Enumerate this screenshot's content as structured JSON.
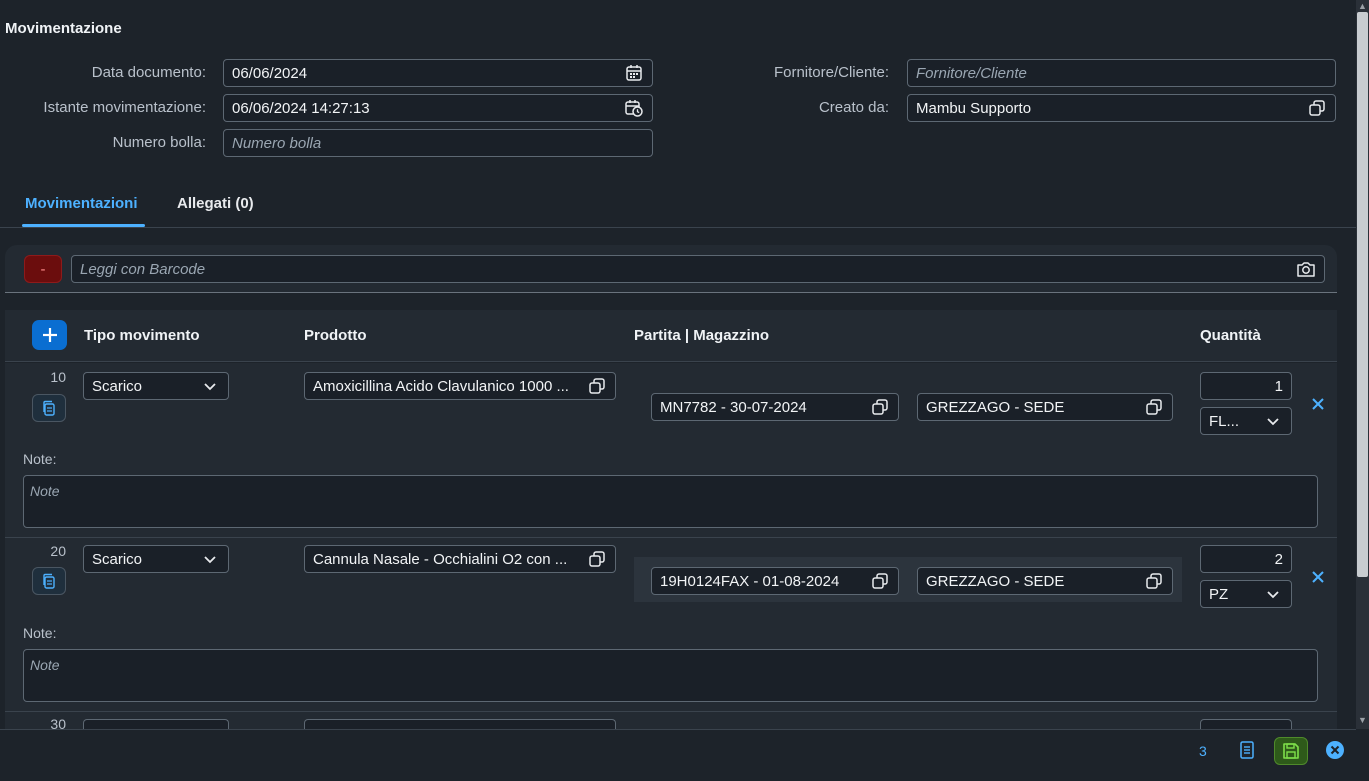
{
  "section": {
    "title": "Movimentazione"
  },
  "form": {
    "data_documento": {
      "label": "Data documento:",
      "value": "06/06/2024"
    },
    "istante": {
      "label": "Istante movimentazione:",
      "value": "06/06/2024 14:27:13"
    },
    "numero_bolla": {
      "label": "Numero bolla:",
      "placeholder": "Numero bolla"
    },
    "fornitore": {
      "label": "Fornitore/Cliente:",
      "placeholder": "Fornitore/Cliente"
    },
    "creato_da": {
      "label": "Creato da:",
      "value": "Mambu Supporto"
    }
  },
  "tabs": [
    {
      "label": "Movimentazioni",
      "active": true
    },
    {
      "label": "Allegati (0)",
      "active": false
    }
  ],
  "barcode": {
    "minus_label": "-",
    "placeholder": "Leggi con Barcode"
  },
  "table": {
    "columns": {
      "tipo": "Tipo movimento",
      "prodotto": "Prodotto",
      "partita": "Partita | Magazzino",
      "quantita": "Quantità"
    },
    "rows": [
      {
        "num": "10",
        "tipo": "Scarico",
        "prodotto": "Amoxicillina Acido Clavulanico 1000 ...",
        "partita": "MN7782 - 30-07-2024",
        "magazzino": "GREZZAGO - SEDE",
        "quantita": "1",
        "unita": "FL...",
        "note_label": "Note:",
        "note_placeholder": "Note"
      },
      {
        "num": "20",
        "tipo": "Scarico",
        "prodotto": "Cannula Nasale - Occhialini O2 con ...",
        "partita": "19H0124FAX - 01-08-2024",
        "magazzino": "GREZZAGO - SEDE",
        "quantita": "2",
        "unita": "PZ",
        "note_label": "Note:",
        "note_placeholder": "Note"
      },
      {
        "num": "30"
      }
    ]
  },
  "footer": {
    "count": "3"
  },
  "colors": {
    "accent": "#4db1ff",
    "primary_button": "#0a6ed1",
    "danger": "#6b0d0d",
    "save": "#2e5a1a"
  }
}
